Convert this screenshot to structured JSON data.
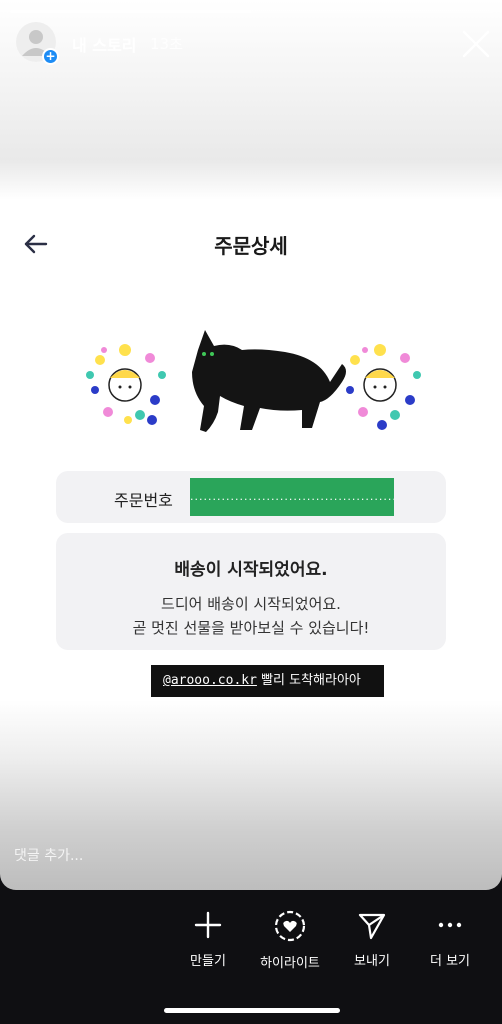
{
  "story": {
    "progress": 0.5,
    "user_name": "내 스토리",
    "time_ago": "13초"
  },
  "screen": {
    "title": "주문상세",
    "order_label": "주문번호",
    "order_value": "................................................",
    "status_title": "배송이 시작되었어요.",
    "status_line1": "드디어 배송이 시작되었어요.",
    "status_line2": "곧 멋진 선물을 받아보실 수 있습니다!"
  },
  "mention": {
    "handle": "@arooo.co.kr",
    "text": "빨리 도착해라아아"
  },
  "comment": {
    "placeholder": "댓글 추가..."
  },
  "actions": [
    {
      "label": "만들기",
      "icon": "plus-icon"
    },
    {
      "label": "하이라이트",
      "icon": "highlight-heart-icon"
    },
    {
      "label": "보내기",
      "icon": "paper-plane-icon"
    },
    {
      "label": "더 보기",
      "icon": "more-icon"
    }
  ],
  "colors": {
    "order_highlight": "#2aa55a",
    "badge_blue": "#1d8cf5",
    "bottom_bar": "#0f0f12"
  }
}
